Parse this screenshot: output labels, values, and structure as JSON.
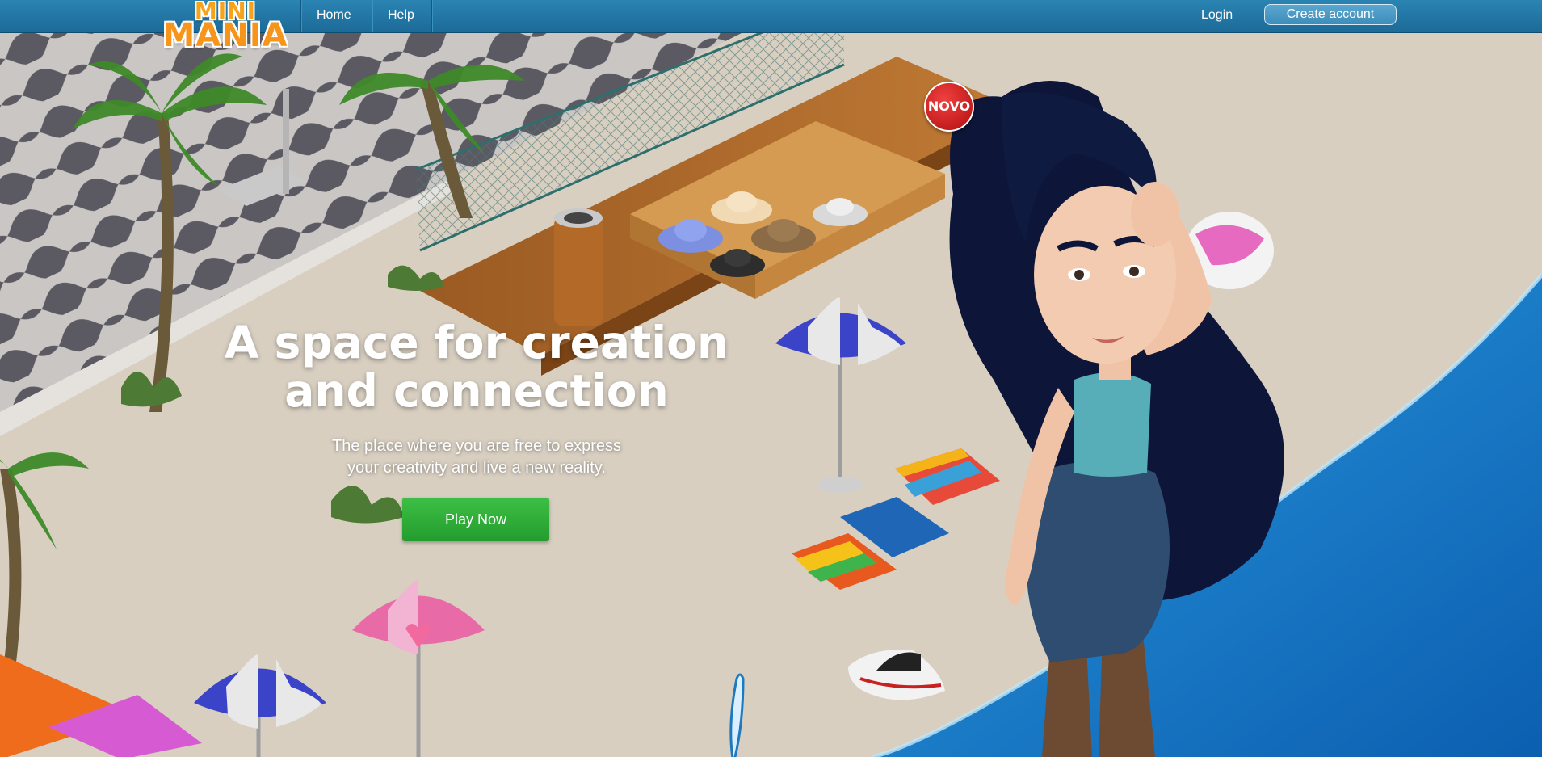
{
  "brand": {
    "logo_line1": "MINI",
    "logo_line2": "MANIA"
  },
  "nav": {
    "home": "Home",
    "help": "Help",
    "login": "Login",
    "create_account": "Create account"
  },
  "hero": {
    "title_line1": "A space for creation",
    "title_line2": "and connection",
    "subtitle_line1": "The place where you are free to express",
    "subtitle_line2": "your creativity and live a new reality.",
    "cta": "Play Now"
  },
  "scene": {
    "badge": "NOVO"
  },
  "colors": {
    "topbar": "#1f73a2",
    "cta_green": "#2fb23a",
    "logo_orange": "#f7a21b",
    "sea_blue": "#1276c4",
    "sand": "#d9d1c3"
  }
}
